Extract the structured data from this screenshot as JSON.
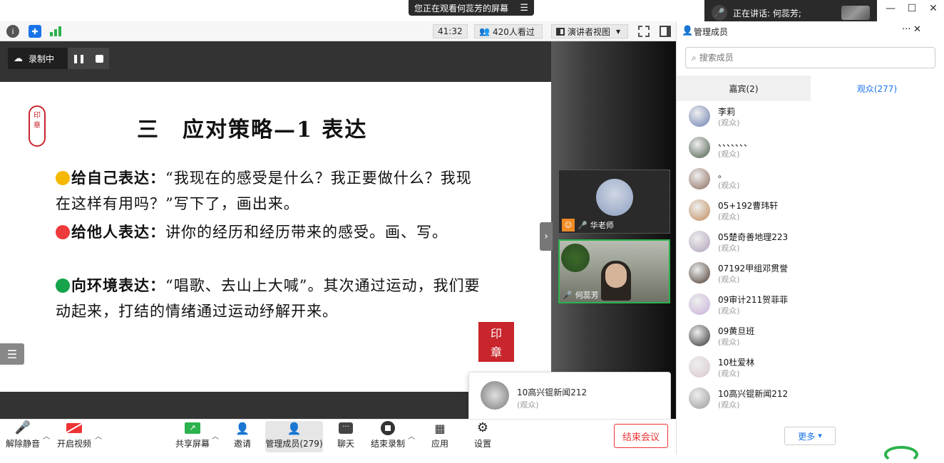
{
  "banner": {
    "text": "您正在观看何蕊芳的屏幕",
    "icon": "menu-icon"
  },
  "speaking": {
    "label": "正在讲话: 何蕊芳;"
  },
  "window": {
    "minimize": "—",
    "maximize": "☐",
    "close": "✕"
  },
  "topbar": {
    "timer": "41:32",
    "viewers": "420人看过",
    "view_mode": "演讲者视图"
  },
  "recording": {
    "label": "录制中"
  },
  "slide": {
    "title": "三　应对策略—1  表达",
    "p1_head": "给自己表达：",
    "p1_body": "“我现在的感受是什么？我正要做什么？我现在这样有用吗？”写下了，画出来。",
    "p2_head": "给他人表达：",
    "p2_body": "讲你的经历和经历带来的感受。画、写。",
    "p3_head": "向环境表达：",
    "p3_body": "“唱歌、去山上大喊”。其次通过运动，我们要动起来，打结的情绪通过运动纾解开来。",
    "colors": {
      "yellow": "#f5b800",
      "red": "#ee3a3a",
      "green": "#16a34a"
    }
  },
  "tiles": [
    {
      "name": "华老师"
    },
    {
      "name": "何蕊芳"
    }
  ],
  "popup": {
    "name": "10高兴锟新闻212",
    "role": "(观众)"
  },
  "bottom": {
    "unmute": "解除静音",
    "video": "开启视频",
    "share": "共享屏幕",
    "invite": "邀请",
    "members": "管理成员(279)",
    "chat": "聊天",
    "end_record": "结束录制",
    "apps": "应用",
    "settings": "设置",
    "end_meeting": "结束会议"
  },
  "panel": {
    "title": "管理成员",
    "search_placeholder": "搜索成员",
    "tab_guests": "嘉宾(2)",
    "tab_audience": "观众(277)",
    "more": "更多",
    "members": [
      {
        "name": "李莉",
        "role": "(观众)",
        "color": "#6a7fb0"
      },
      {
        "name": "、、、、、、、",
        "role": "(观众)",
        "color": "#4a5a4a"
      },
      {
        "name": "。",
        "role": "(观众)",
        "color": "#8a6a5a"
      },
      {
        "name": "05+192曹玮轩",
        "role": "(观众)",
        "color": "#c08a5a"
      },
      {
        "name": "05楚奇善地理223",
        "role": "(观众)",
        "color": "#b0a0b8"
      },
      {
        "name": "07192甲组邓贯誉",
        "role": "(观众)",
        "color": "#4a3a30"
      },
      {
        "name": "09审计211贺菲菲",
        "role": "(观众)",
        "color": "#c8b0d8"
      },
      {
        "name": "09黄旦班",
        "role": "(观众)",
        "color": "#303030"
      },
      {
        "name": "10杜爱林",
        "role": "(观众)",
        "color": "#d8c8d0"
      },
      {
        "name": "10高兴锟新闻212",
        "role": "(观众)",
        "color": "#9a9a9a"
      }
    ]
  },
  "accent": "#1a73e8"
}
